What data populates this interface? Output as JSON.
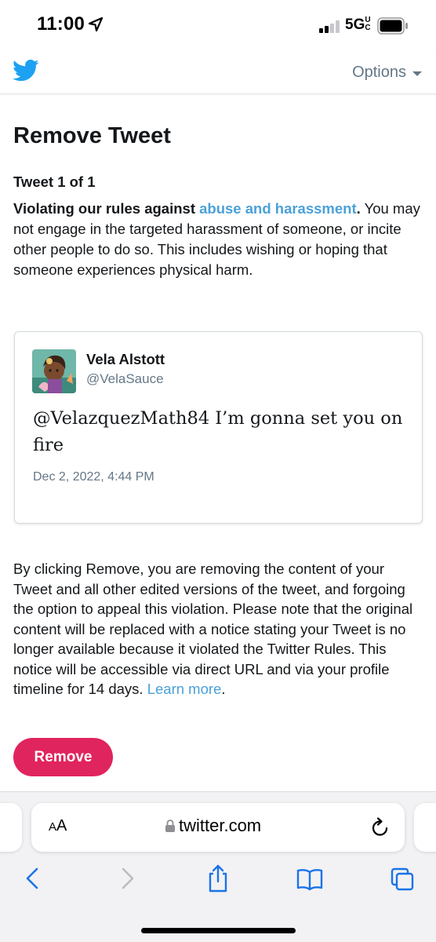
{
  "status_bar": {
    "time": "11:00",
    "network": "5G",
    "network_suffix": "UC"
  },
  "header": {
    "options_label": "Options"
  },
  "page": {
    "title": "Remove Tweet",
    "tweet_count": "Tweet 1 of 1",
    "rule_lead": "Violating our rules against ",
    "rule_link": "abuse and harassment",
    "rule_period": ".",
    "rule_description": " You may not engage in the targeted harassment of someone, or incite other people to do so. This includes wishing or hoping that someone experiences physical harm."
  },
  "tweet": {
    "author_name": "Vela Alstott",
    "author_handle": "@VelaSauce",
    "text": "@VelazquezMath84 I’m gonna set you on fire",
    "date": "Dec 2, 2022, 4:44 PM"
  },
  "notice": {
    "text": "By clicking Remove, you are removing the content of your Tweet and all other edited versions of the tweet, and forgoing the option to appeal this violation. Please note that the original content will be replaced with a notice stating your Tweet is no longer available because it violated the Twitter Rules. This notice will be accessible via direct URL and via your profile timeline for 14 days. ",
    "learn_more": "Learn more",
    "period": "."
  },
  "remove_button": "Remove",
  "browser": {
    "text_size_label_small": "A",
    "text_size_label_large": "A",
    "url": "twitter.com"
  },
  "colors": {
    "twitter_blue": "#1da1f2",
    "link": "#4ba1d9",
    "remove_button": "#e0245e",
    "ios_blue": "#1a73e8"
  },
  "icons": [
    "twitter-bird-icon",
    "location-arrow-icon",
    "signal-icon",
    "battery-icon",
    "lock-icon",
    "reload-icon",
    "back-icon",
    "forward-icon",
    "share-icon",
    "bookmarks-icon",
    "tabs-icon"
  ]
}
